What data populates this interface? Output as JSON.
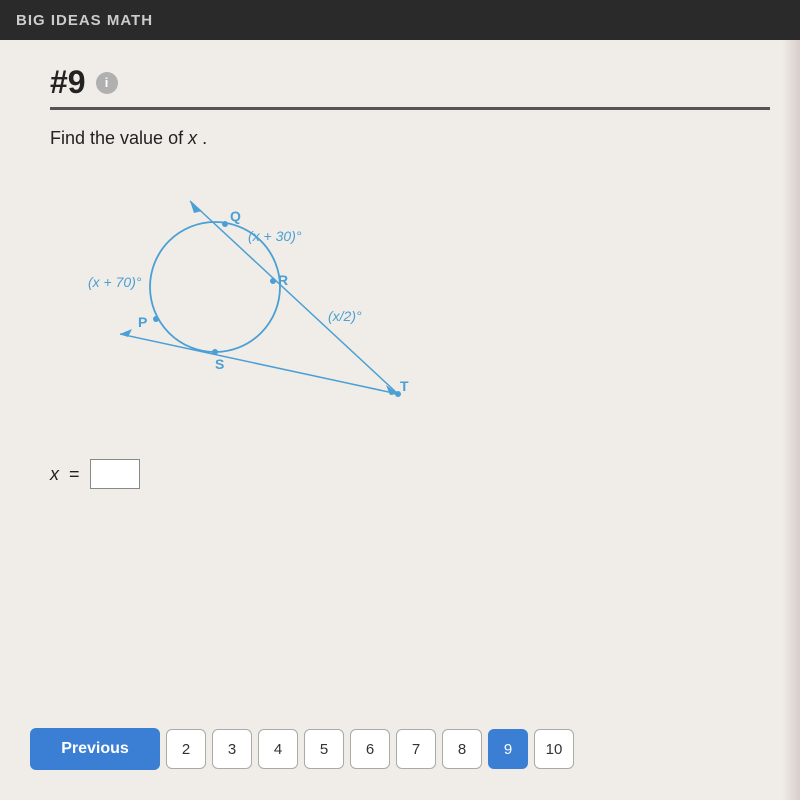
{
  "header": {
    "title": "BIG IDEAS MATH"
  },
  "problem": {
    "number": "#9",
    "info_label": "i",
    "question_text": "Find the value of x .",
    "answer_label": "x",
    "answer_equals": "=",
    "answer_placeholder": ""
  },
  "diagram": {
    "labels": {
      "arc_QR": "(x + 30)°",
      "arc_PQ": "(x + 70)°",
      "arc_ST": "(x/2)°",
      "point_Q": "Q",
      "point_R": "R",
      "point_P": "P",
      "point_S": "S",
      "point_T": "T"
    }
  },
  "navigation": {
    "previous_label": "Previous",
    "pages": [
      "2",
      "3",
      "4",
      "5",
      "6",
      "7",
      "8",
      "9",
      "10"
    ],
    "active_page": "9"
  }
}
